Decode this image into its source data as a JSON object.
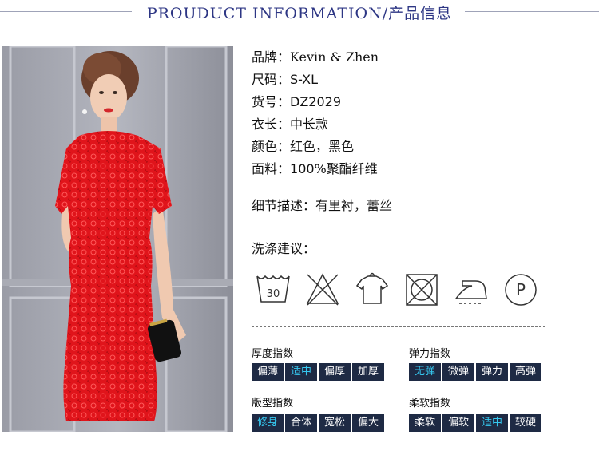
{
  "header": {
    "title": "PROUDUCT INFORMATION/产品信息"
  },
  "product": {
    "brand_label": "品牌：",
    "brand_value": "Kevin & Zhen",
    "size_label": "尺码：",
    "size_value": "S-XL",
    "sku_label": "货号：",
    "sku_value": "DZ2029",
    "length_label": "衣长：",
    "length_value": "中长款",
    "color_label": "颜色：",
    "color_value": "红色，黑色",
    "material_label": "面料：",
    "material_value": "100%聚酯纤维",
    "detail_label": "细节描述：",
    "detail_value": "有里衬，蕾丝",
    "wash_label": "洗涤建议："
  },
  "care": {
    "wash_temp": "30",
    "dryclean_letter": "P",
    "icons": [
      "wash-30-icon",
      "no-bleach-icon",
      "hang-dry-icon",
      "no-tumble-dry-icon",
      "iron-icon",
      "dry-clean-p-icon"
    ]
  },
  "indices": {
    "thickness": {
      "title": "厚度指数",
      "options": [
        "偏薄",
        "适中",
        "偏厚",
        "加厚"
      ],
      "active": 1
    },
    "elasticity": {
      "title": "弹力指数",
      "options": [
        "无弹",
        "微弹",
        "弹力",
        "高弹"
      ],
      "active": 0
    },
    "fit": {
      "title": "版型指数",
      "options": [
        "修身",
        "合体",
        "宽松",
        "偏大"
      ],
      "active": 0
    },
    "softness": {
      "title": "柔软指数",
      "options": [
        "柔软",
        "偏软",
        "适中",
        "较硬"
      ],
      "active": 2
    }
  },
  "colors": {
    "header": "#2d3684",
    "index_bg": "#1e2a44",
    "index_active": "#36c8f0",
    "dress": "#e0141b"
  }
}
